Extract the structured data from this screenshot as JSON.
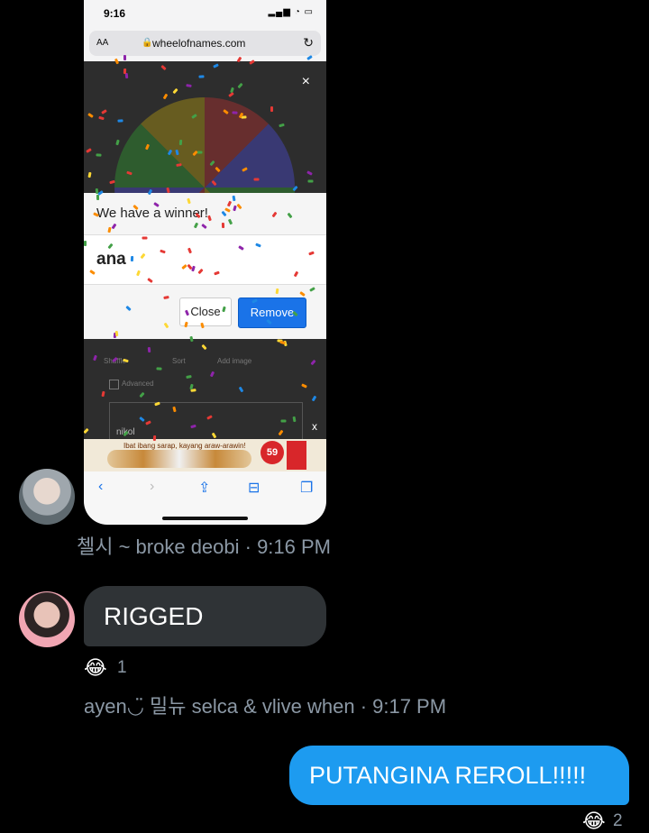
{
  "phone": {
    "status_time": "9:16",
    "url": "wheelofnames.com",
    "aa_label": "AA",
    "wheel_close": "×",
    "dialog": {
      "title": "We have a winner!",
      "winner": "ana",
      "close_label": "Close",
      "remove_label": "Remove"
    },
    "toolbar": {
      "shuffle": "Shuffle",
      "sort": "Sort",
      "add_image": "Add image",
      "advanced": "Advanced"
    },
    "entry": "nikol",
    "ad_close": "x",
    "ad": {
      "text": "Ibat ibang sarap, kayang araw-arawin!",
      "price": "59"
    }
  },
  "messages": [
    {
      "sender_meta": "첼시 ~ broke deobi · 9:16 PM"
    },
    {
      "text": "RIGGED",
      "reaction": {
        "icon": "😂",
        "count": "1"
      },
      "sender_meta": "ayen◡̈ 밀뉴 selca & vlive when · 9:17 PM"
    },
    {
      "text": "PUTANGINA REROLL!!!!!",
      "reaction": {
        "icon": "😂",
        "count": "2"
      },
      "outgoing": true
    }
  ],
  "colors": {
    "background": "#000000",
    "incoming_bubble": "#2f3336",
    "outgoing_bubble": "#1d9bf0",
    "meta_text": "#8b98a5",
    "remove_button": "#1a73e8"
  }
}
